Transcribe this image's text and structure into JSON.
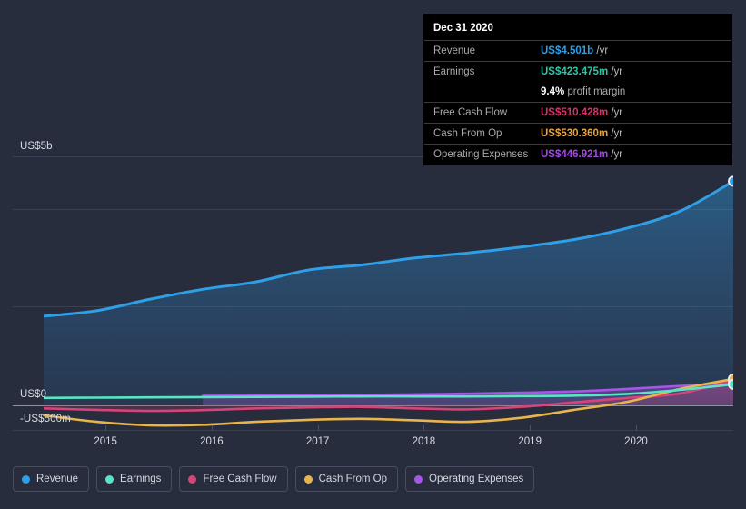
{
  "tooltip": {
    "date": "Dec 31 2020",
    "rows": [
      {
        "key": "Revenue",
        "value": "US$4.501b",
        "unit": "/yr",
        "color": "#2f9fe8"
      },
      {
        "key": "Earnings",
        "value": "US$423.475m",
        "unit": "/yr",
        "color": "#2ec4a6"
      },
      {
        "key": "",
        "value": "9.4%",
        "unit": "profit margin",
        "color": "#ffffff"
      },
      {
        "key": "Free Cash Flow",
        "value": "US$510.428m",
        "unit": "/yr",
        "color": "#d6336c"
      },
      {
        "key": "Cash From Op",
        "value": "US$530.360m",
        "unit": "/yr",
        "color": "#e8a33d"
      },
      {
        "key": "Operating Expenses",
        "value": "US$446.921m",
        "unit": "/yr",
        "color": "#a04be0"
      }
    ]
  },
  "legend": {
    "items": [
      {
        "label": "Revenue",
        "color": "#2f9fe8"
      },
      {
        "label": "Earnings",
        "color": "#5ae3c4"
      },
      {
        "label": "Free Cash Flow",
        "color": "#d6457a"
      },
      {
        "label": "Cash From Op",
        "color": "#e8b44c"
      },
      {
        "label": "Operating Expenses",
        "color": "#a855e8"
      }
    ]
  },
  "axes": {
    "y_top_label": "US$5b",
    "y_zero_label": "US$0",
    "y_neg_label": "-US$500m",
    "x_labels": [
      "2015",
      "2016",
      "2017",
      "2018",
      "2019",
      "2020"
    ]
  },
  "chart_data": {
    "type": "area",
    "title": "",
    "subtitle": "",
    "xlabel": "",
    "ylabel": "",
    "ylim": [
      -500,
      5000
    ],
    "ylim_units": "US$ millions",
    "grid": true,
    "legend_position": "bottom-left",
    "y_ticks": [
      5000,
      0,
      -500
    ],
    "y_tick_labels": [
      "US$5b",
      "US$0",
      "-US$500m"
    ],
    "x_ticks": [
      "2015",
      "2016",
      "2017",
      "2018",
      "2019",
      "2020"
    ],
    "x_range": [
      "2014-06",
      "2020-12"
    ],
    "highlight_point": "Dec 31 2020",
    "series": [
      {
        "name": "Revenue",
        "color": "#2f9fe8",
        "filled": true,
        "x": [
          "2014-06",
          "2014-12",
          "2015-06",
          "2015-12",
          "2016-06",
          "2016-12",
          "2017-06",
          "2017-12",
          "2018-06",
          "2018-12",
          "2019-06",
          "2019-12",
          "2020-06",
          "2020-12"
        ],
        "values": [
          1790,
          1900,
          2130,
          2330,
          2480,
          2720,
          2820,
          2960,
          3060,
          3180,
          3330,
          3560,
          3900,
          4501
        ]
      },
      {
        "name": "Earnings",
        "color": "#5ae3c4",
        "filled": false,
        "x": [
          "2014-06",
          "2014-12",
          "2015-06",
          "2015-12",
          "2016-06",
          "2016-12",
          "2017-06",
          "2017-12",
          "2018-06",
          "2018-12",
          "2019-06",
          "2019-12",
          "2020-06",
          "2020-12"
        ],
        "values": [
          150,
          155,
          160,
          165,
          170,
          175,
          180,
          180,
          180,
          185,
          195,
          230,
          310,
          423
        ]
      },
      {
        "name": "Free Cash Flow",
        "color": "#d6457a",
        "filled": false,
        "x": [
          "2014-06",
          "2014-12",
          "2015-06",
          "2015-12",
          "2016-06",
          "2016-12",
          "2017-06",
          "2017-12",
          "2018-06",
          "2018-12",
          "2019-06",
          "2019-12",
          "2020-06",
          "2020-12"
        ],
        "values": [
          -60,
          -90,
          -110,
          -95,
          -60,
          -40,
          -30,
          -60,
          -80,
          -30,
          60,
          150,
          240,
          510
        ]
      },
      {
        "name": "Cash From Op",
        "color": "#e8b44c",
        "filled": false,
        "x": [
          "2014-06",
          "2014-12",
          "2015-06",
          "2015-12",
          "2016-06",
          "2016-12",
          "2017-06",
          "2017-12",
          "2018-06",
          "2018-12",
          "2019-06",
          "2019-12",
          "2020-06",
          "2020-12"
        ],
        "values": [
          -200,
          -330,
          -400,
          -390,
          -330,
          -290,
          -270,
          -300,
          -330,
          -250,
          -90,
          70,
          330,
          530
        ]
      },
      {
        "name": "Operating Expenses",
        "color": "#a855e8",
        "filled": false,
        "x": [
          "2015-12",
          "2016-06",
          "2016-12",
          "2017-06",
          "2017-12",
          "2018-06",
          "2018-12",
          "2019-06",
          "2019-12",
          "2020-06",
          "2020-12"
        ],
        "values": [
          190,
          195,
          200,
          210,
          220,
          235,
          255,
          280,
          330,
          390,
          447
        ]
      }
    ]
  }
}
